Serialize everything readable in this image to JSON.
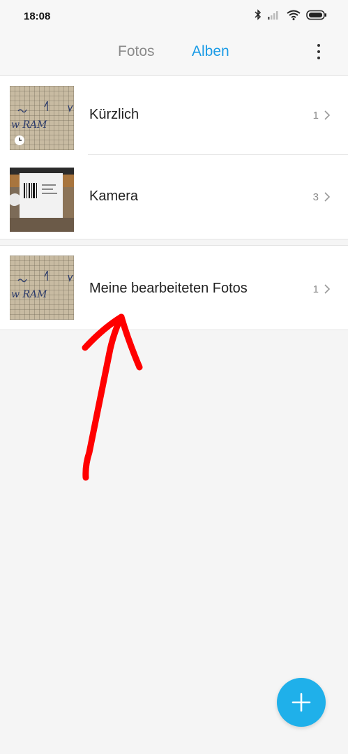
{
  "status_bar": {
    "time": "18:08",
    "icons": [
      "bluetooth-icon",
      "signal-icon",
      "wifi-icon",
      "battery-icon"
    ]
  },
  "header": {
    "tabs": [
      {
        "label": "Fotos",
        "active": false
      },
      {
        "label": "Alben",
        "active": true
      }
    ],
    "menu_icon": "more-vert-icon"
  },
  "albums": [
    {
      "name": "Kürzlich",
      "count": "1",
      "thumb_icon": "clock-icon"
    },
    {
      "name": "Kamera",
      "count": "3"
    },
    {
      "name": "Meine bearbeiteten Fotos",
      "count": "1"
    }
  ],
  "fab": {
    "icon": "plus-icon"
  },
  "colors": {
    "accent": "#1a9be6",
    "fab": "#1fb0ea",
    "annotation": "#ff0000"
  }
}
